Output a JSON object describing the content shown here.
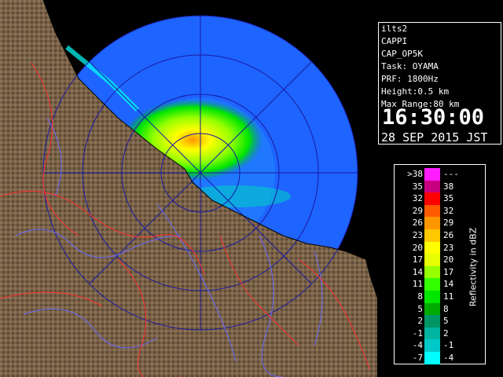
{
  "info": {
    "lines": [
      "ilts2",
      "CAPPI",
      "CAP_OP5K",
      "Task: OYAMA",
      "PRF: 1800Hz",
      "Height:0.5 km",
      "Max Range:80 km"
    ],
    "time": "16:30:00",
    "date": "28 SEP 2015 JST"
  },
  "legend": {
    "title": "Reflectivity in dBZ",
    "rows": [
      {
        "lo": ">38",
        "hi": "---",
        "color": "#ff1cff"
      },
      {
        "lo": "35",
        "hi": "38",
        "color": "#c8007f"
      },
      {
        "lo": "32",
        "hi": "35",
        "color": "#ff0000"
      },
      {
        "lo": "29",
        "hi": "32",
        "color": "#ff5a00"
      },
      {
        "lo": "26",
        "hi": "29",
        "color": "#ff9600"
      },
      {
        "lo": "23",
        "hi": "26",
        "color": "#ffc800"
      },
      {
        "lo": "20",
        "hi": "23",
        "color": "#ffff00"
      },
      {
        "lo": "17",
        "hi": "20",
        "color": "#e6ff00"
      },
      {
        "lo": "14",
        "hi": "17",
        "color": "#96ff00"
      },
      {
        "lo": "11",
        "hi": "14",
        "color": "#32ff00"
      },
      {
        "lo": "8",
        "hi": "11",
        "color": "#00e600"
      },
      {
        "lo": "5",
        "hi": "8",
        "color": "#00aa00"
      },
      {
        "lo": "2",
        "hi": "5",
        "color": "#009664"
      },
      {
        "lo": "-1",
        "hi": "2",
        "color": "#00b4a0"
      },
      {
        "lo": "-4",
        "hi": "-1",
        "color": "#00c8c8"
      },
      {
        "lo": "-7",
        "hi": "-4",
        "color": "#00ffff"
      }
    ]
  },
  "colors": {
    "sea": "#1e64ff",
    "echo_background": "#1e78ff",
    "land": "#7a6248",
    "range_rings": "#1a1aa0",
    "rivers": "#6b6bff",
    "boundaries": "#ff3030"
  }
}
